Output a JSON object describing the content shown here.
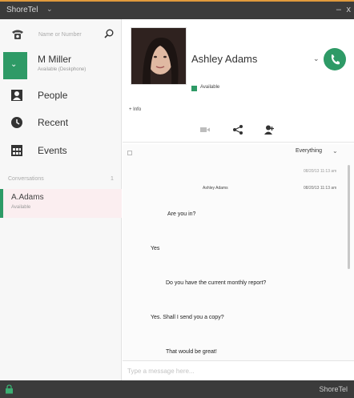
{
  "titlebar": {
    "app_name": "ShoreTel",
    "menu_icon": "chevron-down-icon",
    "minimize": "–",
    "close": "x"
  },
  "sidebar": {
    "search_placeholder": "Name or Number",
    "user": {
      "name": "M Miller",
      "status": "Available (Deskphone)"
    },
    "nav": [
      {
        "label": "People",
        "icon": "person-card-icon"
      },
      {
        "label": "Recent",
        "icon": "history-icon"
      },
      {
        "label": "Events",
        "icon": "calendar-icon"
      }
    ],
    "conversations_header": "Conversations",
    "conversations_count": "1",
    "conversation": {
      "name": "A.Adams",
      "status": "Available"
    }
  },
  "contact": {
    "name": "Ashley Adams",
    "status": "Available",
    "info_toggle": "+ Info",
    "accent": "#2e9a66"
  },
  "chat": {
    "filter": "Everything",
    "timestamp_1": "08/20/13 11:13 am",
    "timestamp_2": "08/20/13 11:13 am",
    "sender": "Ashley Adams",
    "messages": [
      "Are you in?",
      "Yes",
      "Do you have the current monthly report?",
      "Yes. Shall I send you a copy?",
      "That would be great!"
    ],
    "compose_placeholder": "Type a message here..."
  },
  "statusbar": {
    "brand": "ShoreTel"
  }
}
